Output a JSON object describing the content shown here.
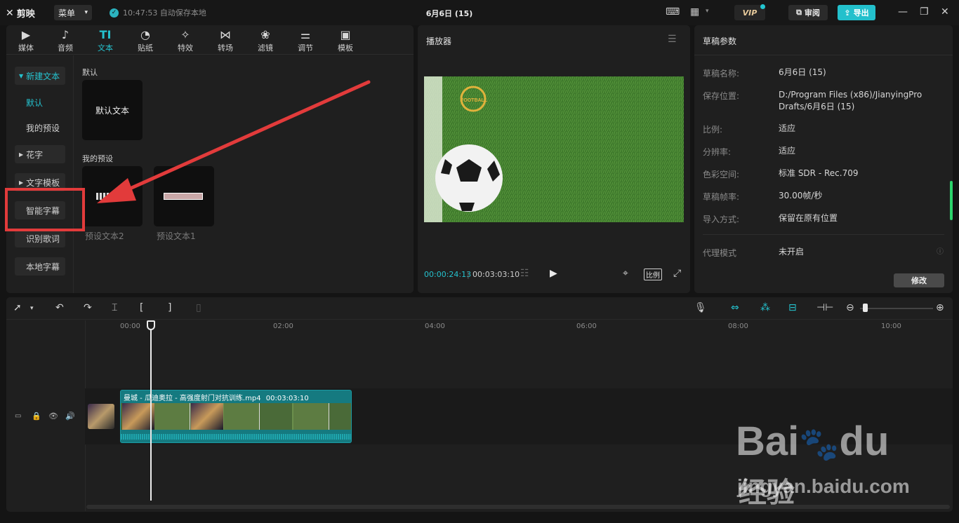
{
  "app": {
    "logo_text": "剪映",
    "menu_label": "菜单",
    "autosave_text": "10:47:53 自动保存本地",
    "doc_title": "6月6日 (15)",
    "vip_label": "VIP",
    "review_label": "审阅",
    "export_label": "导出",
    "accent_color": "#25c2ce"
  },
  "media_tabs": [
    {
      "label": "媒体",
      "icon": "media-icon"
    },
    {
      "label": "音频",
      "icon": "audio-icon"
    },
    {
      "label": "文本",
      "icon": "text-icon",
      "active": true
    },
    {
      "label": "贴纸",
      "icon": "sticker-icon"
    },
    {
      "label": "特效",
      "icon": "effects-icon"
    },
    {
      "label": "转场",
      "icon": "transition-icon"
    },
    {
      "label": "滤镜",
      "icon": "filter-icon"
    },
    {
      "label": "调节",
      "icon": "adjust-icon"
    },
    {
      "label": "模板",
      "icon": "template-icon"
    }
  ],
  "sidebar": {
    "new_text": "新建文本",
    "default": "默认",
    "my_presets": "我的预设",
    "fancy_text": "花字",
    "text_template": "文字模板",
    "smart_subtitle": "智能字幕",
    "lyrics": "识别歌词",
    "local_subtitle": "本地字幕"
  },
  "content": {
    "default_section": "默认",
    "default_card": "默认文本",
    "preset_section": "我的预设",
    "preset2_caption": "预设文本2",
    "preset1_caption": "预设文本1"
  },
  "player": {
    "title": "播放器",
    "current_time": "00:00:24:13",
    "total_time": "00:03:03:10",
    "ratio_label": "比例",
    "video_logo_text": "FOOTBALL"
  },
  "draft": {
    "title": "草稿参数",
    "params": [
      {
        "label": "草稿名称:",
        "value": "6月6日 (15)"
      },
      {
        "label": "保存位置:",
        "value": "D:/Program Files (x86)/JianyingPro Drafts/6月6日 (15)"
      },
      {
        "label": "比例:",
        "value": "适应"
      },
      {
        "label": "分辨率:",
        "value": "适应"
      },
      {
        "label": "色彩空间:",
        "value": "标准 SDR - Rec.709"
      },
      {
        "label": "草稿帧率:",
        "value": "30.00帧/秒"
      },
      {
        "label": "导入方式:",
        "value": "保留在原有位置"
      },
      {
        "label": "代理模式",
        "value": "未开启"
      }
    ],
    "modify_label": "修改"
  },
  "timeline": {
    "ticks": [
      "00:00",
      "02:00",
      "04:00",
      "06:00",
      "08:00",
      "10:00"
    ],
    "clip_name": "曼城 - 瓜迪奥拉 - 高强度射门对抗训练.mp4",
    "clip_duration": "00:03:03:10"
  },
  "watermark": {
    "brand": "Bai",
    "brand2": "du",
    "cn": "经验",
    "url": "jingyan.baidu.com"
  }
}
